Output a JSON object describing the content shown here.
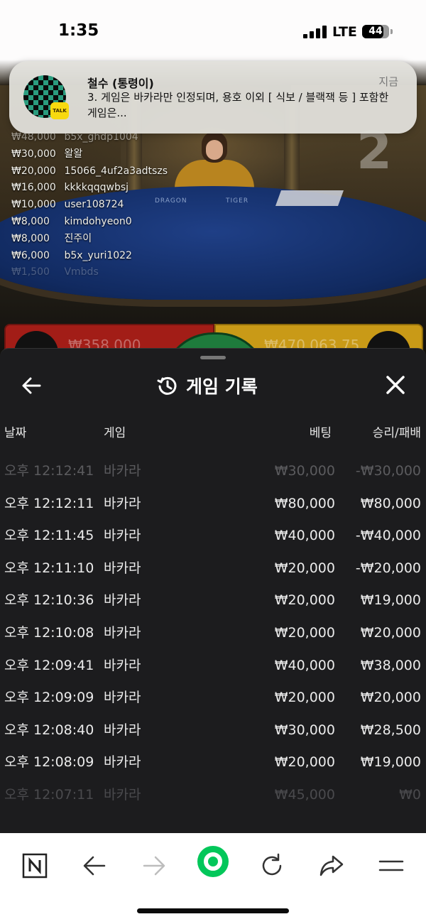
{
  "status_bar": {
    "time": "1:35",
    "network": "LTE",
    "battery": "44"
  },
  "notification": {
    "app": "KakaoTalk",
    "badge": "TALK",
    "sender": "철수 (통령이)",
    "time": "지금",
    "message": "3. 게임은 바카라만 인정되며, 용호 이외 [ 식보 / 블랙잭 등 ] 포함한 게임은..."
  },
  "live_table": {
    "round_number": "2",
    "table_labels": [
      "DRAGON",
      "TIGER"
    ],
    "bettors": [
      {
        "amount": "₩48,000",
        "name": "b5x_ghdp1004"
      },
      {
        "amount": "₩30,000",
        "name": "왈왈"
      },
      {
        "amount": "₩20,000",
        "name": "15066_4uf2a3adtszs"
      },
      {
        "amount": "₩16,000",
        "name": "kkkkqqqwbsj"
      },
      {
        "amount": "₩10,000",
        "name": "user108724"
      },
      {
        "amount": "₩8,000",
        "name": "kimdohyeon0"
      },
      {
        "amount": "₩8,000",
        "name": "진주이"
      },
      {
        "amount": "₩6,000",
        "name": "b5x_yuri1022"
      },
      {
        "amount": "₩1,500",
        "name": "Vmbds"
      }
    ],
    "left_total": "₩358,000",
    "right_total": "₩470,063.75",
    "colors": {
      "left": "#a21d17",
      "right": "#c99a17",
      "center": "#1e7b3c"
    }
  },
  "game_history": {
    "title": "게임 기록",
    "columns": {
      "date": "날짜",
      "game": "게임",
      "bet": "베팅",
      "result": "승리/패배"
    },
    "rows": [
      {
        "time": "오후 12:12:41",
        "game": "바카라",
        "bet": "₩30,000",
        "result": "-₩30,000"
      },
      {
        "time": "오후 12:12:11",
        "game": "바카라",
        "bet": "₩80,000",
        "result": "₩80,000"
      },
      {
        "time": "오후 12:11:45",
        "game": "바카라",
        "bet": "₩40,000",
        "result": "-₩40,000"
      },
      {
        "time": "오후 12:11:10",
        "game": "바카라",
        "bet": "₩20,000",
        "result": "-₩20,000"
      },
      {
        "time": "오후 12:10:36",
        "game": "바카라",
        "bet": "₩20,000",
        "result": "₩19,000"
      },
      {
        "time": "오후 12:10:08",
        "game": "바카라",
        "bet": "₩20,000",
        "result": "₩20,000"
      },
      {
        "time": "오후 12:09:41",
        "game": "바카라",
        "bet": "₩40,000",
        "result": "₩38,000"
      },
      {
        "time": "오후 12:09:09",
        "game": "바카라",
        "bet": "₩20,000",
        "result": "₩20,000"
      },
      {
        "time": "오후 12:08:40",
        "game": "바카라",
        "bet": "₩30,000",
        "result": "₩28,500"
      },
      {
        "time": "오후 12:08:09",
        "game": "바카라",
        "bet": "₩20,000",
        "result": "₩19,000"
      },
      {
        "time": "오후 12:07:11",
        "game": "바카라",
        "bet": "₩45,000",
        "result": "₩0"
      }
    ]
  },
  "browser_toolbar": {
    "icons": [
      "naver-home-icon",
      "back-arrow-icon",
      "forward-arrow-icon",
      "green-dot-icon",
      "reload-icon",
      "share-icon",
      "menu-icon"
    ],
    "accent": "#03c75a"
  }
}
